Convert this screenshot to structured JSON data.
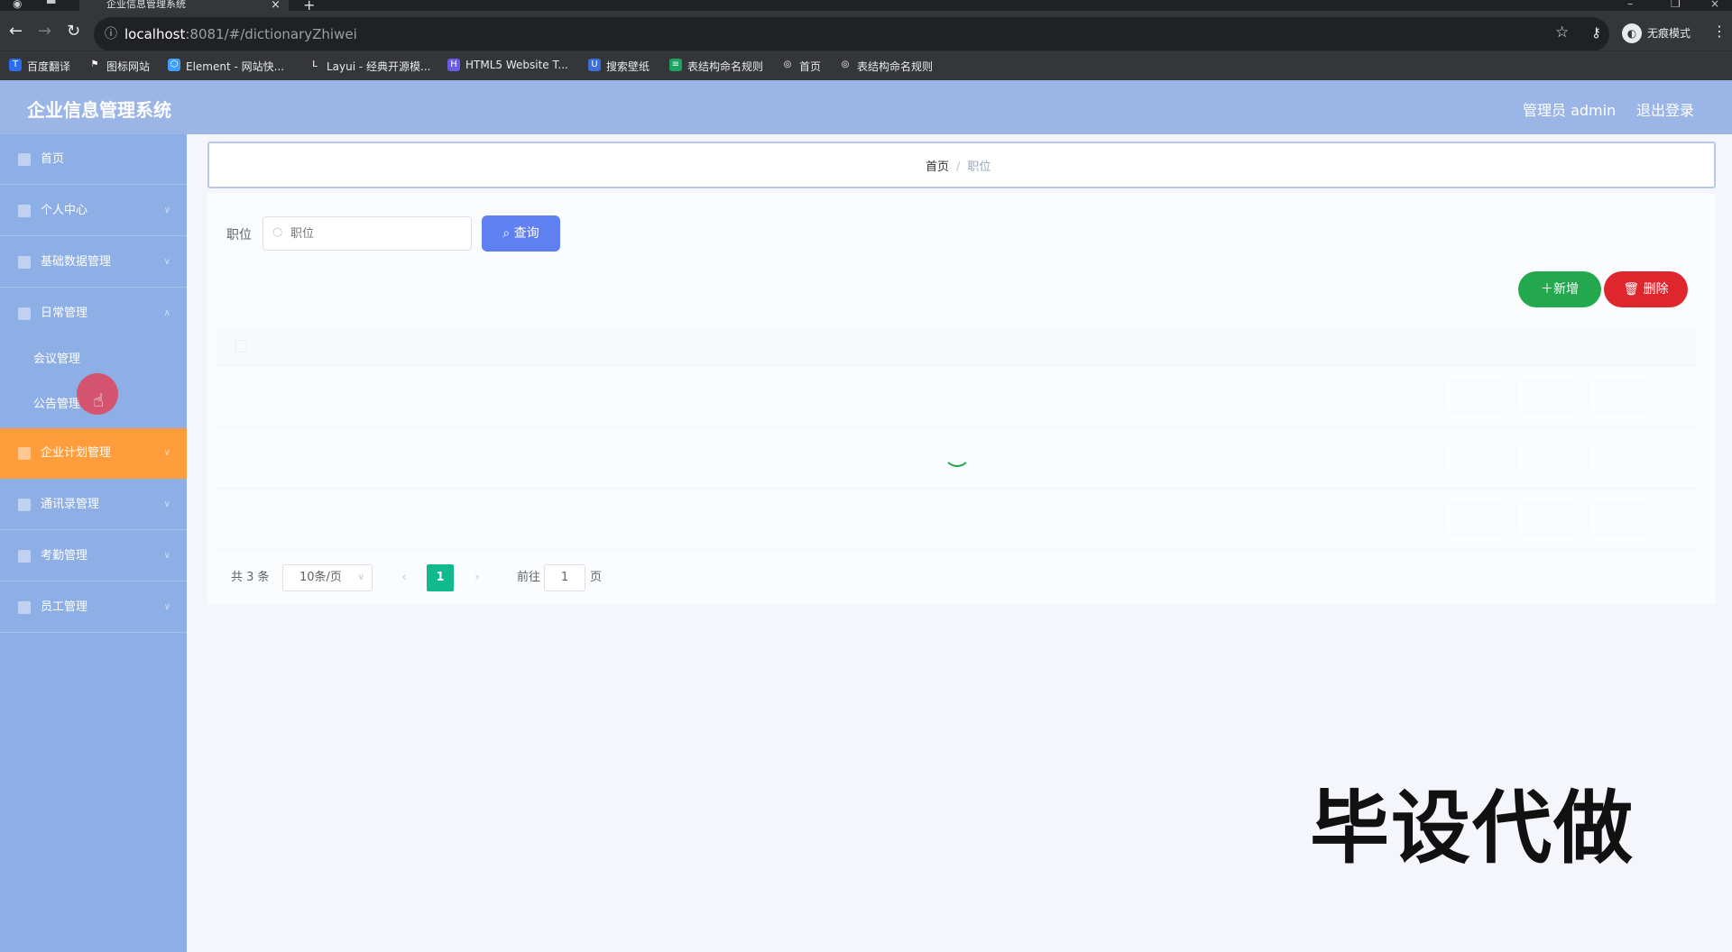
{
  "browser": {
    "tab_title": "企业信息管理系统",
    "url_host": "localhost",
    "url_path": ":8081/#/dictionaryZhiwei",
    "incognito_label": "无痕模式",
    "bookmarks": [
      "百度翻译",
      "图标网站",
      "Element - 网站快...",
      "Layui - 经典开源模...",
      "HTML5 Website T...",
      "搜索壁纸",
      "表结构命名规则",
      "首页",
      "表结构命名规则"
    ]
  },
  "header": {
    "title": "企业信息管理系统",
    "admin": "管理员 admin",
    "logout": "退出登录"
  },
  "sidebar": {
    "items": [
      {
        "label": "首页"
      },
      {
        "label": "个人中心"
      },
      {
        "label": "基础数据管理"
      },
      {
        "label": "日常管理"
      },
      {
        "label": "企业计划管理"
      },
      {
        "label": "通讯录管理"
      },
      {
        "label": "考勤管理"
      },
      {
        "label": "员工管理"
      }
    ],
    "subitems": [
      {
        "label": "会议管理"
      },
      {
        "label": "公告管理"
      }
    ]
  },
  "breadcrumb": {
    "home": "首页",
    "separator": "/",
    "current": "职位"
  },
  "search": {
    "label": "职位",
    "placeholder": "职位",
    "query_button": "查询"
  },
  "actions": {
    "add": "新增",
    "delete": "删除"
  },
  "pagination": {
    "total": "共 3 条",
    "page_size": "10条/页",
    "current_page": "1",
    "goto_label": "前往",
    "goto_value": "1",
    "page_unit": "页"
  },
  "watermark": "毕设代做",
  "colors": {
    "header_bg": "#9bb5e6",
    "sidebar_bg": "#8eaee6",
    "active_item": "#ff9d3c",
    "query_btn": "#5f80f0",
    "add_btn": "#23a84d",
    "delete_btn": "#e0262d",
    "current_page": "#12b98c"
  }
}
